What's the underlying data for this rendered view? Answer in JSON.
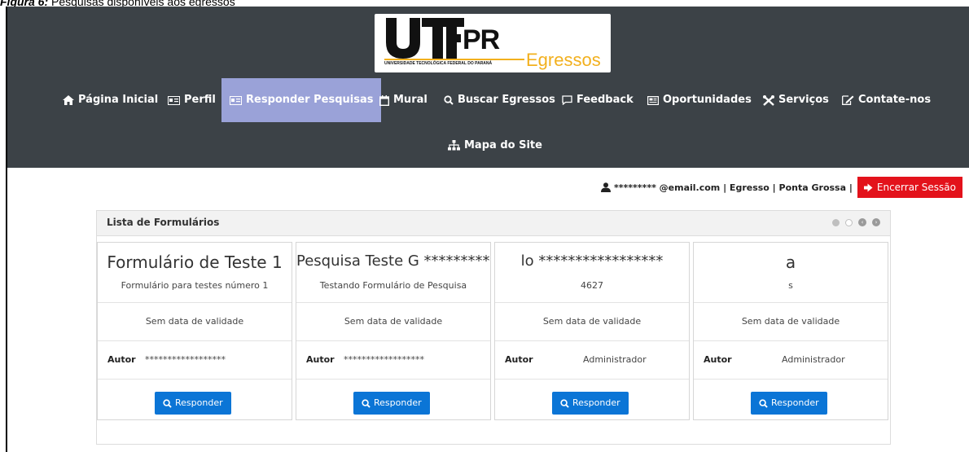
{
  "caption": {
    "bold": "Figura 6:",
    "text": " Pesquisas disponíveis aos egressos"
  },
  "logo": {
    "pr": "PR",
    "egressos": "Egressos",
    "university": "UNIVERSIDADE TECNOLÓGICA FEDERAL DO PARANÁ"
  },
  "nav": {
    "items": [
      {
        "label": "Página Inicial",
        "icon": "home-icon"
      },
      {
        "label": "Perfil",
        "icon": "id-card-icon"
      },
      {
        "label": "Responder Pesquisas",
        "icon": "id-card-icon",
        "active": true
      },
      {
        "label": "Mural",
        "icon": "calendar-icon"
      },
      {
        "label": "Buscar Egressos",
        "icon": "search-icon"
      },
      {
        "label": "Feedback",
        "icon": "comment-icon"
      },
      {
        "label": "Oportunidades",
        "icon": "newspaper-icon"
      },
      {
        "label": "Serviços",
        "icon": "tools-icon"
      },
      {
        "label": "Contate-nos",
        "icon": "edit-icon"
      }
    ],
    "sitemap": {
      "label": "Mapa do Site",
      "icon": "sitemap-icon"
    }
  },
  "user": {
    "email": "********* @email.com | Egresso | Ponta Grossa |",
    "logout": "Encerrar Sessão"
  },
  "panel": {
    "title": "Lista de Formulários",
    "author_label": "Autor",
    "button_label": "Responder",
    "cards": [
      {
        "title": "Formulário de Teste 1",
        "description": "Formulário para testes número 1",
        "validity": "Sem data de validade",
        "author": "******************"
      },
      {
        "title": "Pesquisa Teste G ***********",
        "description": "Testando Formulário de Pesquisa",
        "validity": "Sem data de validade",
        "author": "******************"
      },
      {
        "title": "lo *****************",
        "description": "4627",
        "validity": "Sem data de validade",
        "author": "Administrador"
      },
      {
        "title": "a",
        "description": "s",
        "validity": "Sem data de validade",
        "author": "Administrador"
      }
    ]
  },
  "colors": {
    "header": "#3c4247",
    "active_tab": "#9aa2d8",
    "primary": "#0b75d6",
    "danger": "#e3121b",
    "brand": "#f2b01e"
  }
}
